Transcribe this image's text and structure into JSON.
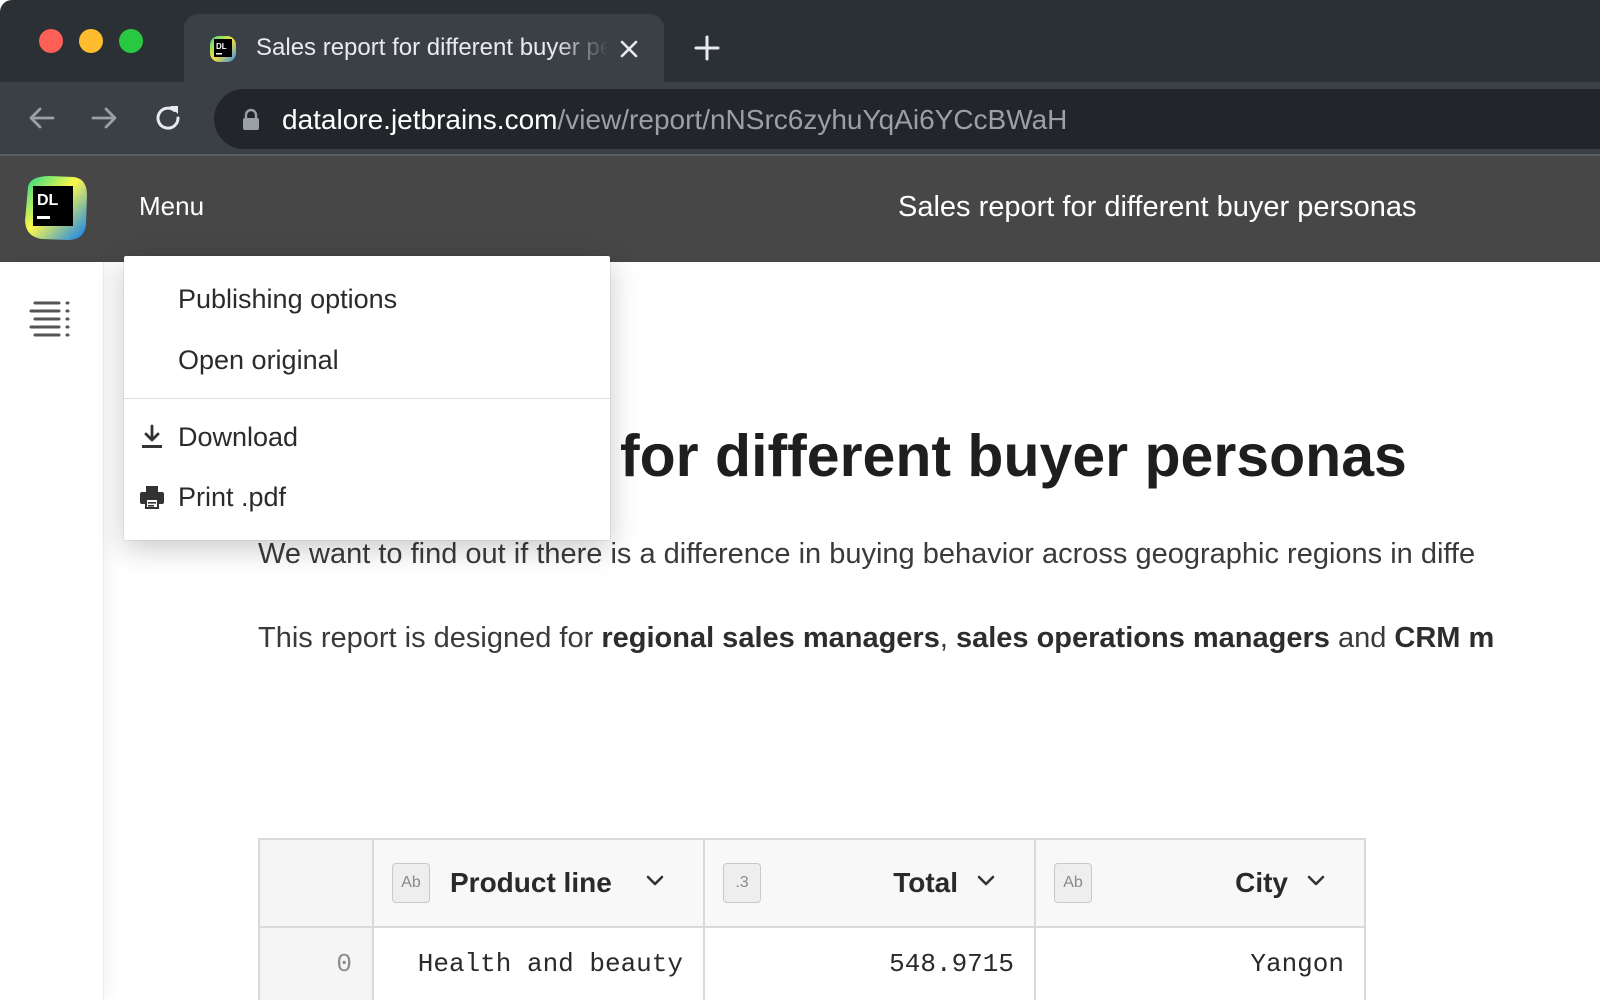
{
  "browser": {
    "tab_title": "Sales report for different buyer personas",
    "url_host": "datalore.jetbrains.com",
    "url_path": "/view/report/nNSrc6zyhuYqAi6YCcBWaH"
  },
  "header": {
    "logo_text": "DL",
    "menu_label": "Menu",
    "title": "Sales report for different buyer personas"
  },
  "menu": {
    "items": [
      {
        "label": "Publishing options"
      },
      {
        "label": "Open original"
      },
      {
        "label": "Download",
        "icon": "download-icon"
      },
      {
        "label": "Print .pdf",
        "icon": "printer-icon"
      }
    ]
  },
  "report": {
    "title_visible": "for different buyer personas",
    "intro": "We want to find out if there is a difference in buying behavior across geographic regions in diffe",
    "audience_prefix": "This report is designed for ",
    "audience_role1": "regional sales managers",
    "audience_sep": ", ",
    "audience_role2": "sales operations managers",
    "audience_and": " and ",
    "audience_role3": "CRM m"
  },
  "table": {
    "columns": [
      {
        "type_badge": "Ab",
        "label": "Product line"
      },
      {
        "type_badge": ".3",
        "label": "Total"
      },
      {
        "type_badge": "Ab",
        "label": "City"
      }
    ],
    "rows": [
      {
        "index": "0",
        "product_line": "Health and beauty",
        "total": "548.9715",
        "city": "Yangon"
      }
    ]
  }
}
